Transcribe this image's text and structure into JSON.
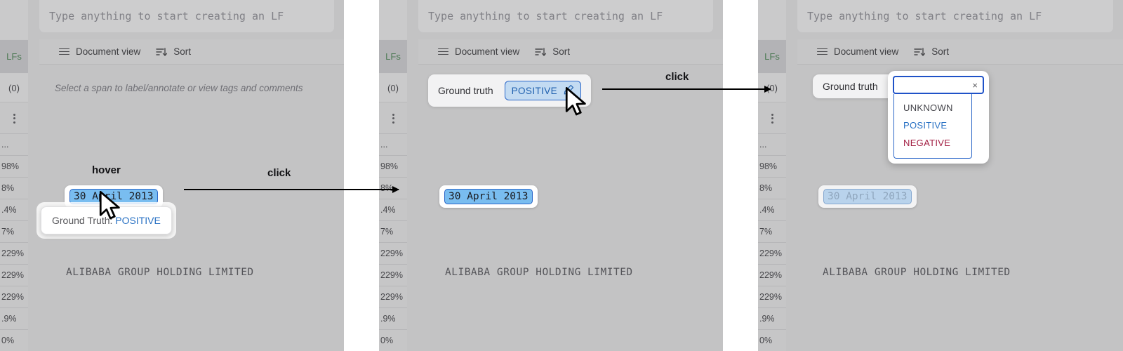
{
  "app": {
    "search_placeholder": "Type anything to start creating an LF",
    "toolbar": {
      "document_view": "Document view",
      "sort": "Sort"
    },
    "hint": "Select a span to label/annotate or view tags and comments",
    "document_text": "ALIBABA GROUP HOLDING LIMITED",
    "span_text": "30 April 2013"
  },
  "rail": {
    "tab_label": "LFs",
    "count_label": "(0)",
    "rows": [
      "...",
      "98%",
      "8%",
      ".4%",
      "7%",
      "229%",
      "229%",
      "229%",
      ".9%",
      "0%"
    ]
  },
  "panel1": {
    "annotation": "hover",
    "tooltip_label": "Ground Truth:",
    "tooltip_value": "POSITIVE"
  },
  "panel2": {
    "gt_label": "Ground truth",
    "gt_value": "POSITIVE",
    "edit_icon": "pencil-icon"
  },
  "panel3": {
    "gt_label": "Ground truth",
    "dropdown": {
      "input_value": "",
      "clear_glyph": "×",
      "options": [
        {
          "label": "UNKNOWN",
          "color": "#44444a"
        },
        {
          "label": "POSITIVE",
          "color": "#2a72c4"
        },
        {
          "label": "NEGATIVE",
          "color": "#a31f43"
        }
      ]
    }
  },
  "annotations": {
    "arrow1": "click",
    "arrow2": "click"
  },
  "colors": {
    "accent_blue": "#2a66c8",
    "positive": "#2a72c4",
    "negative": "#a31f43",
    "unknown": "#44444a",
    "lf_green": "#4e7a55",
    "panel_bg": "#c3c3c5"
  }
}
